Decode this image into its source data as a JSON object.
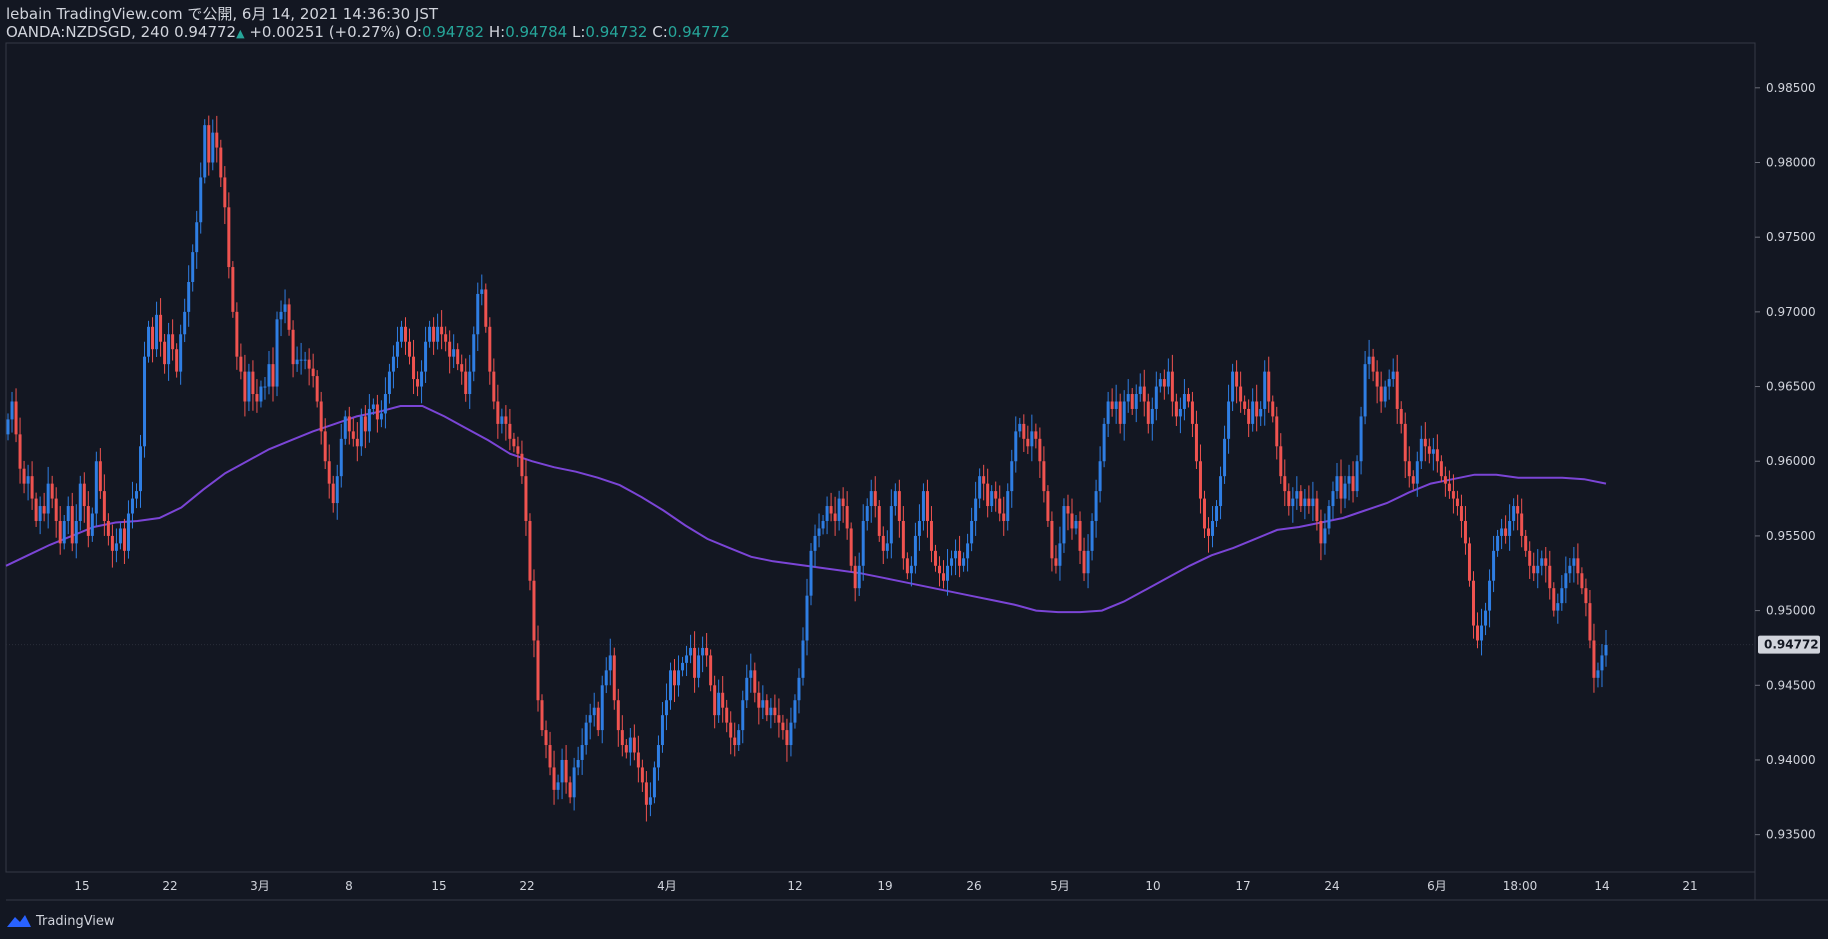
{
  "header": {
    "publisher_line": "lebain TradingView.com で公開, 6月 14, 2021 14:36:30 JST",
    "symbol": "OANDA:NZDSGD, 240",
    "last": "0.94772",
    "change": "+0.00251 (+0.27%)",
    "o_label": "O:",
    "o_value": "0.94782",
    "h_label": "H:",
    "h_value": "0.94784",
    "l_label": "L:",
    "l_value": "0.94732",
    "c_label": "C:",
    "c_value": "0.94772"
  },
  "footer": {
    "brand": "TradingView",
    "icon": "tradingview-logo-icon"
  },
  "colors": {
    "background": "#131722",
    "bull": "#2f7ee3",
    "bear": "#ef5350",
    "ma": "#7b45d6",
    "price_tag": "#d1d4dc",
    "axis_text": "#d1d4dc"
  },
  "chart_data": {
    "type": "candlestick",
    "price_axis_labels": [
      "0.98500",
      "0.98000",
      "0.97500",
      "0.97000",
      "0.96500",
      "0.96000",
      "0.95500",
      "0.95000",
      "0.94500",
      "0.94000",
      "0.93500"
    ],
    "ylim": [
      0.9325,
      0.988
    ],
    "time_axis_labels": [
      "15",
      "22",
      "3月",
      "8",
      "15",
      "22",
      "4月",
      "12",
      "19",
      "26",
      "5月",
      "10",
      "17",
      "24",
      "6月",
      "18:00",
      "14",
      "21"
    ],
    "current_price": "0.94772",
    "grid": false,
    "close_series": [
      0.9628,
      0.964,
      0.9618,
      0.9595,
      0.9585,
      0.959,
      0.9575,
      0.956,
      0.957,
      0.9565,
      0.9585,
      0.9575,
      0.956,
      0.9545,
      0.956,
      0.957,
      0.9545,
      0.956,
      0.9585,
      0.957,
      0.955,
      0.9565,
      0.96,
      0.958,
      0.956,
      0.955,
      0.954,
      0.9545,
      0.9555,
      0.954,
      0.9565,
      0.9575,
      0.958,
      0.961,
      0.967,
      0.969,
      0.9675,
      0.9698,
      0.968,
      0.9665,
      0.9685,
      0.9675,
      0.966,
      0.9685,
      0.97,
      0.972,
      0.974,
      0.976,
      0.979,
      0.9825,
      0.98,
      0.982,
      0.981,
      0.979,
      0.977,
      0.973,
      0.97,
      0.967,
      0.966,
      0.964,
      0.966,
      0.9645,
      0.964,
      0.965,
      0.965,
      0.9665,
      0.965,
      0.9695,
      0.97,
      0.9705,
      0.9688,
      0.9665,
      0.9668,
      0.9668,
      0.9668,
      0.9662,
      0.9657,
      0.964,
      0.962,
      0.96,
      0.9585,
      0.9572,
      0.959,
      0.9615,
      0.963,
      0.962,
      0.9615,
      0.961,
      0.963,
      0.962,
      0.9635,
      0.9638,
      0.9628,
      0.9632,
      0.9645,
      0.966,
      0.967,
      0.968,
      0.969,
      0.968,
      0.967,
      0.9655,
      0.965,
      0.966,
      0.968,
      0.969,
      0.968,
      0.969,
      0.9685,
      0.968,
      0.967,
      0.9675,
      0.9665,
      0.966,
      0.9645,
      0.966,
      0.9685,
      0.9712,
      0.9715,
      0.969,
      0.966,
      0.964,
      0.9625,
      0.963,
      0.9625,
      0.9615,
      0.961,
      0.9605,
      0.959,
      0.956,
      0.952,
      0.948,
      0.944,
      0.942,
      0.941,
      0.9395,
      0.938,
      0.9385,
      0.94,
      0.9385,
      0.9375,
      0.9395,
      0.94,
      0.941,
      0.9425,
      0.943,
      0.9435,
      0.942,
      0.945,
      0.946,
      0.947,
      0.944,
      0.942,
      0.941,
      0.9405,
      0.9415,
      0.9405,
      0.9395,
      0.9385,
      0.937,
      0.9375,
      0.9395,
      0.941,
      0.943,
      0.944,
      0.946,
      0.945,
      0.946,
      0.9465,
      0.947,
      0.9475,
      0.9455,
      0.947,
      0.9475,
      0.947,
      0.945,
      0.943,
      0.9445,
      0.9435,
      0.9425,
      0.9415,
      0.941,
      0.942,
      0.944,
      0.9455,
      0.946,
      0.9445,
      0.9435,
      0.944,
      0.943,
      0.9435,
      0.943,
      0.9425,
      0.942,
      0.941,
      0.9425,
      0.944,
      0.9455,
      0.948,
      0.951,
      0.954,
      0.955,
      0.9555,
      0.956,
      0.957,
      0.9565,
      0.956,
      0.9575,
      0.957,
      0.9555,
      0.953,
      0.9515,
      0.953,
      0.956,
      0.957,
      0.958,
      0.957,
      0.955,
      0.954,
      0.9545,
      0.957,
      0.958,
      0.956,
      0.9535,
      0.9525,
      0.953,
      0.955,
      0.956,
      0.958,
      0.956,
      0.954,
      0.953,
      0.9525,
      0.952,
      0.953,
      0.9535,
      0.954,
      0.953,
      0.9535,
      0.9545,
      0.956,
      0.9575,
      0.959,
      0.9585,
      0.957,
      0.958,
      0.9575,
      0.9565,
      0.956,
      0.958,
      0.96,
      0.962,
      0.9625,
      0.9615,
      0.961,
      0.962,
      0.9615,
      0.96,
      0.958,
      0.956,
      0.9535,
      0.953,
      0.9545,
      0.957,
      0.9565,
      0.9555,
      0.956,
      0.954,
      0.9525,
      0.954,
      0.956,
      0.958,
      0.96,
      0.9625,
      0.964,
      0.9635,
      0.964,
      0.9625,
      0.964,
      0.9645,
      0.9635,
      0.9645,
      0.965,
      0.964,
      0.9625,
      0.9635,
      0.965,
      0.9655,
      0.965,
      0.966,
      0.964,
      0.963,
      0.9635,
      0.9645,
      0.964,
      0.9625,
      0.96,
      0.9575,
      0.9555,
      0.955,
      0.956,
      0.957,
      0.959,
      0.9615,
      0.964,
      0.966,
      0.965,
      0.964,
      0.9635,
      0.9625,
      0.964,
      0.963,
      0.9635,
      0.966,
      0.964,
      0.963,
      0.961,
      0.959,
      0.958,
      0.957,
      0.9575,
      0.958,
      0.957,
      0.9575,
      0.957,
      0.9575,
      0.956,
      0.9545,
      0.9555,
      0.957,
      0.958,
      0.959,
      0.9575,
      0.9585,
      0.959,
      0.958,
      0.96,
      0.963,
      0.9665,
      0.967,
      0.966,
      0.965,
      0.964,
      0.965,
      0.9655,
      0.966,
      0.9635,
      0.9625,
      0.96,
      0.959,
      0.9585,
      0.96,
      0.9615,
      0.961,
      0.9605,
      0.9608,
      0.96,
      0.959,
      0.9585,
      0.958,
      0.9575,
      0.957,
      0.956,
      0.9545,
      0.952,
      0.949,
      0.948,
      0.949,
      0.95,
      0.952,
      0.954,
      0.955,
      0.9555,
      0.955,
      0.956,
      0.957,
      0.9565,
      0.955,
      0.954,
      0.953,
      0.9525,
      0.953,
      0.9535,
      0.953,
      0.9515,
      0.95,
      0.9505,
      0.9515,
      0.9525,
      0.953,
      0.9535,
      0.9525,
      0.9515,
      0.9505,
      0.948,
      0.9455,
      0.946,
      0.947,
      0.9477
    ],
    "ma_series": [
      0.953,
      0.9537,
      0.9544,
      0.955,
      0.9556,
      0.9559,
      0.956,
      0.9562,
      0.9569,
      0.9581,
      0.9592,
      0.96,
      0.9608,
      0.9614,
      0.962,
      0.9625,
      0.963,
      0.9633,
      0.9637,
      0.9637,
      0.963,
      0.9622,
      0.9614,
      0.9605,
      0.96,
      0.9596,
      0.9593,
      0.9589,
      0.9584,
      0.9576,
      0.9567,
      0.9557,
      0.9548,
      0.9542,
      0.9536,
      0.9533,
      0.9531,
      0.9529,
      0.9527,
      0.9525,
      0.9522,
      0.9519,
      0.9516,
      0.9513,
      0.951,
      0.9507,
      0.9504,
      0.95,
      0.9499,
      0.9499,
      0.95,
      0.9506,
      0.9514,
      0.9522,
      0.953,
      0.9537,
      0.9542,
      0.9548,
      0.9554,
      0.9556,
      0.9559,
      0.9562,
      0.9567,
      0.9572,
      0.9579,
      0.9585,
      0.9588,
      0.9591,
      0.9591,
      0.9589,
      0.9589,
      0.9589,
      0.9588,
      0.9585
    ]
  }
}
